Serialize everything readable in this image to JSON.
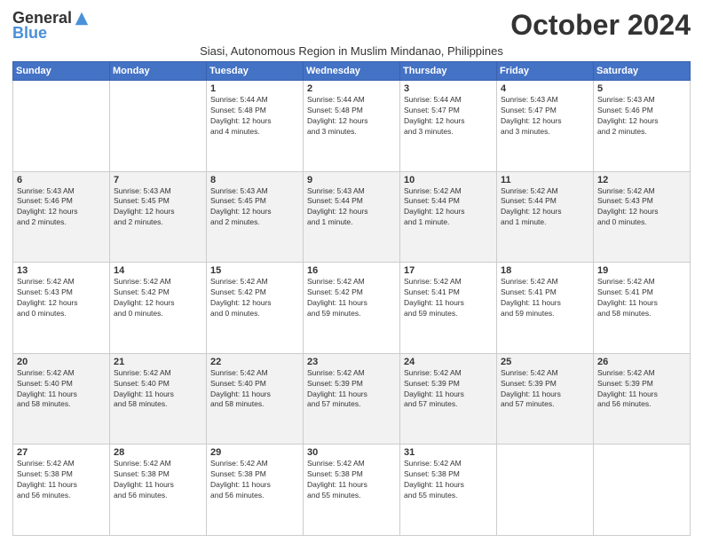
{
  "logo": {
    "general": "General",
    "blue": "Blue"
  },
  "title": "October 2024",
  "subtitle": "Siasi, Autonomous Region in Muslim Mindanao, Philippines",
  "days_of_week": [
    "Sunday",
    "Monday",
    "Tuesday",
    "Wednesday",
    "Thursday",
    "Friday",
    "Saturday"
  ],
  "weeks": [
    [
      {
        "day": "",
        "info": ""
      },
      {
        "day": "",
        "info": ""
      },
      {
        "day": "1",
        "info": "Sunrise: 5:44 AM\nSunset: 5:48 PM\nDaylight: 12 hours\nand 4 minutes."
      },
      {
        "day": "2",
        "info": "Sunrise: 5:44 AM\nSunset: 5:48 PM\nDaylight: 12 hours\nand 3 minutes."
      },
      {
        "day": "3",
        "info": "Sunrise: 5:44 AM\nSunset: 5:47 PM\nDaylight: 12 hours\nand 3 minutes."
      },
      {
        "day": "4",
        "info": "Sunrise: 5:43 AM\nSunset: 5:47 PM\nDaylight: 12 hours\nand 3 minutes."
      },
      {
        "day": "5",
        "info": "Sunrise: 5:43 AM\nSunset: 5:46 PM\nDaylight: 12 hours\nand 2 minutes."
      }
    ],
    [
      {
        "day": "6",
        "info": "Sunrise: 5:43 AM\nSunset: 5:46 PM\nDaylight: 12 hours\nand 2 minutes."
      },
      {
        "day": "7",
        "info": "Sunrise: 5:43 AM\nSunset: 5:45 PM\nDaylight: 12 hours\nand 2 minutes."
      },
      {
        "day": "8",
        "info": "Sunrise: 5:43 AM\nSunset: 5:45 PM\nDaylight: 12 hours\nand 2 minutes."
      },
      {
        "day": "9",
        "info": "Sunrise: 5:43 AM\nSunset: 5:44 PM\nDaylight: 12 hours\nand 1 minute."
      },
      {
        "day": "10",
        "info": "Sunrise: 5:42 AM\nSunset: 5:44 PM\nDaylight: 12 hours\nand 1 minute."
      },
      {
        "day": "11",
        "info": "Sunrise: 5:42 AM\nSunset: 5:44 PM\nDaylight: 12 hours\nand 1 minute."
      },
      {
        "day": "12",
        "info": "Sunrise: 5:42 AM\nSunset: 5:43 PM\nDaylight: 12 hours\nand 0 minutes."
      }
    ],
    [
      {
        "day": "13",
        "info": "Sunrise: 5:42 AM\nSunset: 5:43 PM\nDaylight: 12 hours\nand 0 minutes."
      },
      {
        "day": "14",
        "info": "Sunrise: 5:42 AM\nSunset: 5:42 PM\nDaylight: 12 hours\nand 0 minutes."
      },
      {
        "day": "15",
        "info": "Sunrise: 5:42 AM\nSunset: 5:42 PM\nDaylight: 12 hours\nand 0 minutes."
      },
      {
        "day": "16",
        "info": "Sunrise: 5:42 AM\nSunset: 5:42 PM\nDaylight: 11 hours\nand 59 minutes."
      },
      {
        "day": "17",
        "info": "Sunrise: 5:42 AM\nSunset: 5:41 PM\nDaylight: 11 hours\nand 59 minutes."
      },
      {
        "day": "18",
        "info": "Sunrise: 5:42 AM\nSunset: 5:41 PM\nDaylight: 11 hours\nand 59 minutes."
      },
      {
        "day": "19",
        "info": "Sunrise: 5:42 AM\nSunset: 5:41 PM\nDaylight: 11 hours\nand 58 minutes."
      }
    ],
    [
      {
        "day": "20",
        "info": "Sunrise: 5:42 AM\nSunset: 5:40 PM\nDaylight: 11 hours\nand 58 minutes."
      },
      {
        "day": "21",
        "info": "Sunrise: 5:42 AM\nSunset: 5:40 PM\nDaylight: 11 hours\nand 58 minutes."
      },
      {
        "day": "22",
        "info": "Sunrise: 5:42 AM\nSunset: 5:40 PM\nDaylight: 11 hours\nand 58 minutes."
      },
      {
        "day": "23",
        "info": "Sunrise: 5:42 AM\nSunset: 5:39 PM\nDaylight: 11 hours\nand 57 minutes."
      },
      {
        "day": "24",
        "info": "Sunrise: 5:42 AM\nSunset: 5:39 PM\nDaylight: 11 hours\nand 57 minutes."
      },
      {
        "day": "25",
        "info": "Sunrise: 5:42 AM\nSunset: 5:39 PM\nDaylight: 11 hours\nand 57 minutes."
      },
      {
        "day": "26",
        "info": "Sunrise: 5:42 AM\nSunset: 5:39 PM\nDaylight: 11 hours\nand 56 minutes."
      }
    ],
    [
      {
        "day": "27",
        "info": "Sunrise: 5:42 AM\nSunset: 5:38 PM\nDaylight: 11 hours\nand 56 minutes."
      },
      {
        "day": "28",
        "info": "Sunrise: 5:42 AM\nSunset: 5:38 PM\nDaylight: 11 hours\nand 56 minutes."
      },
      {
        "day": "29",
        "info": "Sunrise: 5:42 AM\nSunset: 5:38 PM\nDaylight: 11 hours\nand 56 minutes."
      },
      {
        "day": "30",
        "info": "Sunrise: 5:42 AM\nSunset: 5:38 PM\nDaylight: 11 hours\nand 55 minutes."
      },
      {
        "day": "31",
        "info": "Sunrise: 5:42 AM\nSunset: 5:38 PM\nDaylight: 11 hours\nand 55 minutes."
      },
      {
        "day": "",
        "info": ""
      },
      {
        "day": "",
        "info": ""
      }
    ]
  ]
}
